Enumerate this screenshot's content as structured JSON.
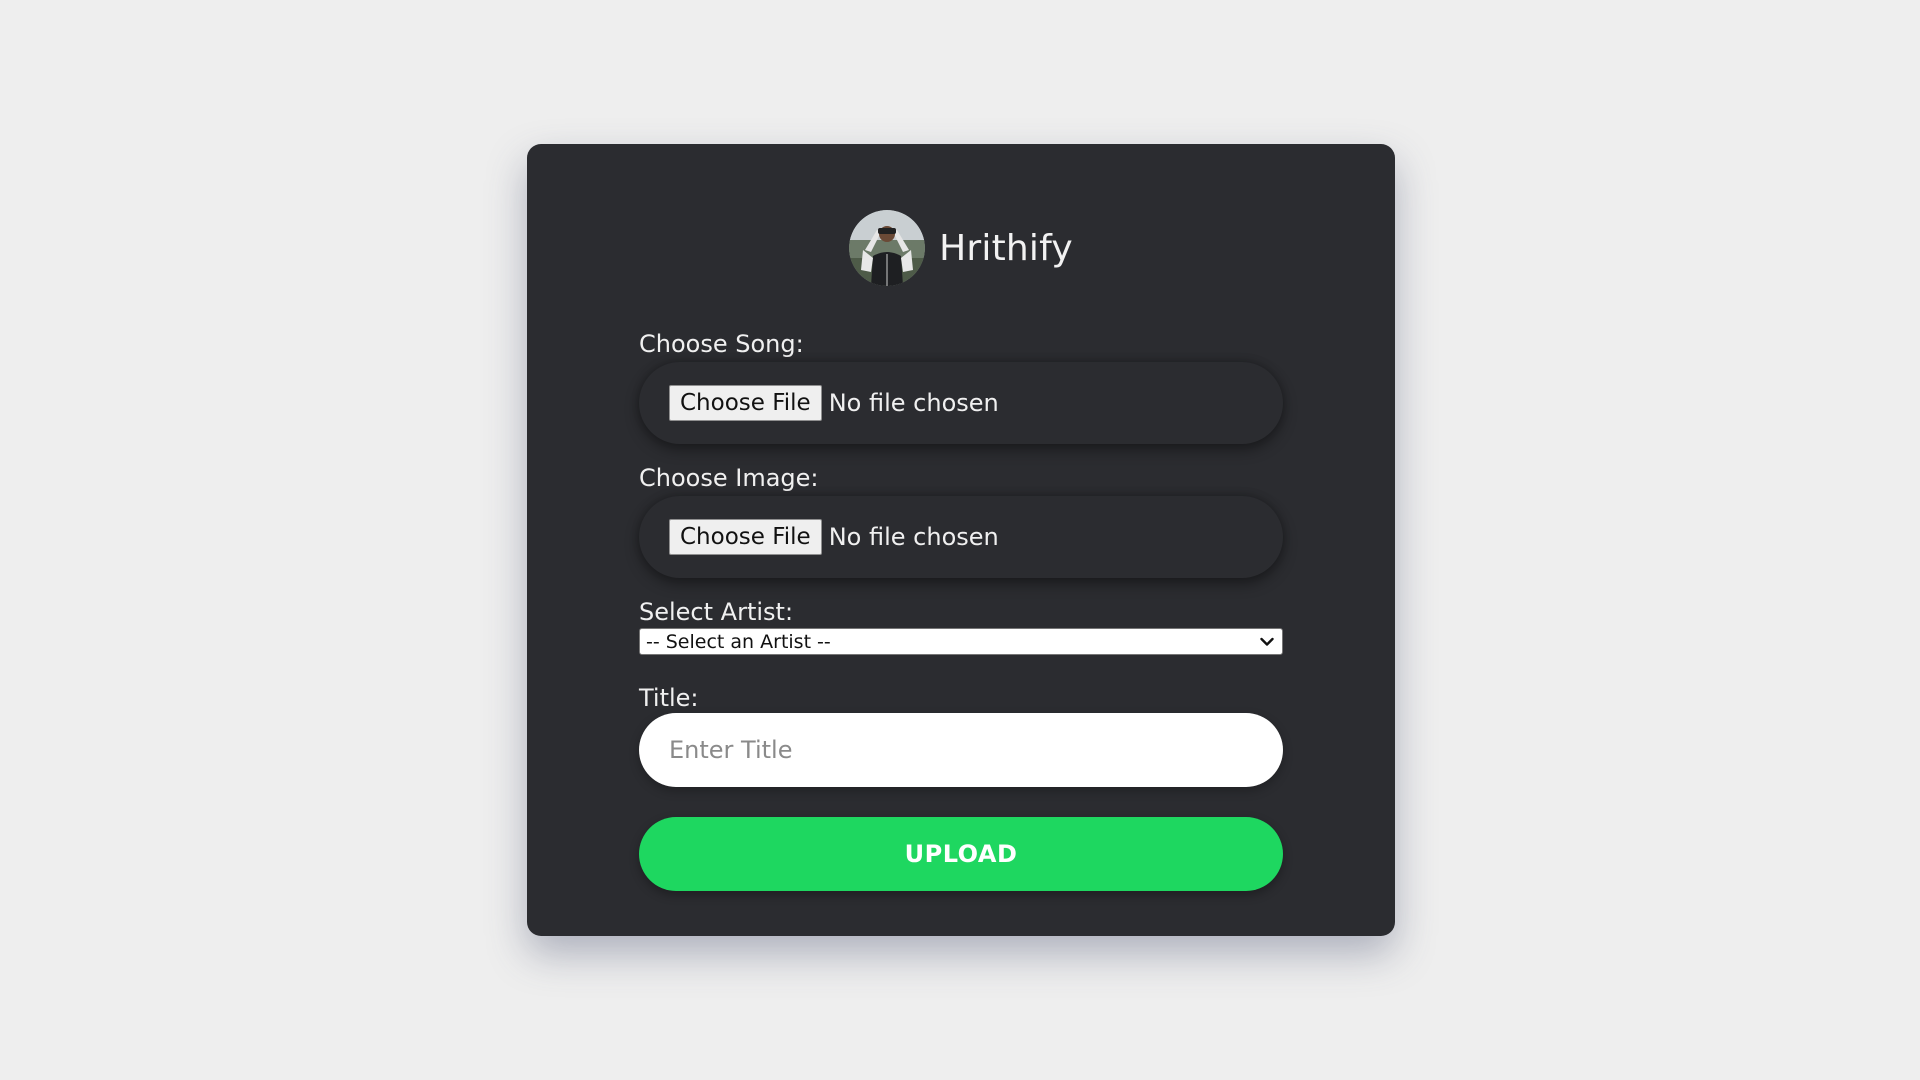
{
  "brand": {
    "name": "Hrithify",
    "avatar_icon": "user-avatar-photo"
  },
  "form": {
    "song": {
      "label": "Choose Song:",
      "button_label": "Choose File",
      "status": "No file chosen"
    },
    "image": {
      "label": "Choose Image:",
      "button_label": "Choose File",
      "status": "No file chosen"
    },
    "artist": {
      "label": "Select Artist:",
      "selected": "-- Select an Artist --",
      "dropdown_icon": "chevron-down-icon"
    },
    "title": {
      "label": "Title:",
      "placeholder": "Enter Title",
      "value": ""
    },
    "upload_label": "UPLOAD"
  },
  "colors": {
    "page_background": "#eeeeee",
    "card_background": "#2b2c30",
    "accent": "#1ed760",
    "text": "#f0f0f0"
  }
}
